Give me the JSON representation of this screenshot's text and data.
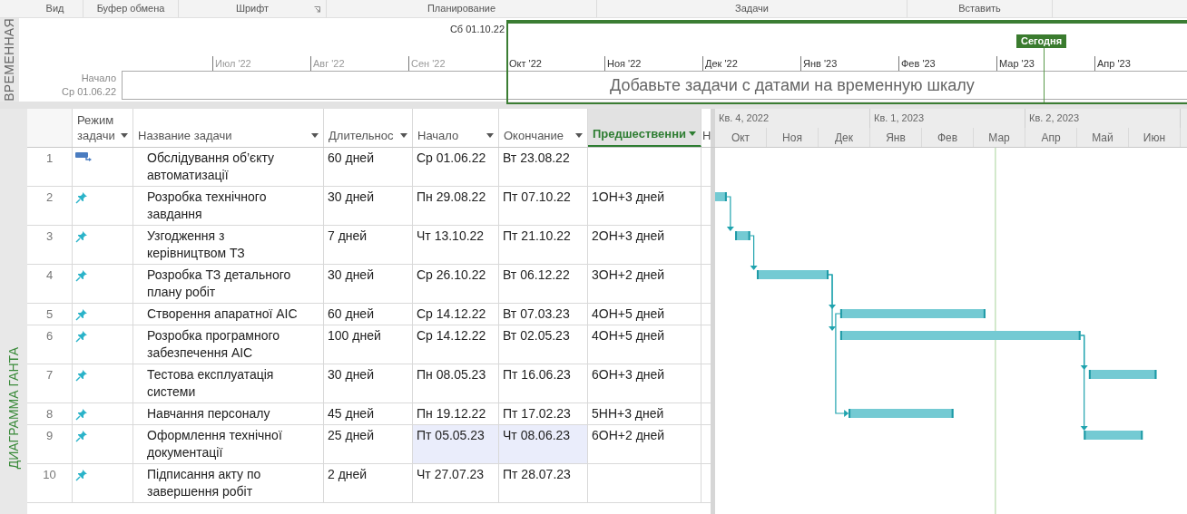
{
  "ribbon_groups": [
    {
      "label": "Вид",
      "launcher": false
    },
    {
      "label": "Буфер обмена",
      "launcher": false
    },
    {
      "label": "Шрифт",
      "launcher": true
    },
    {
      "label": "Планирование",
      "launcher": false
    },
    {
      "label": "Задачи",
      "launcher": false
    },
    {
      "label": "Вставить",
      "launcher": false
    }
  ],
  "timeline": {
    "side_label": "ВРЕМЕННАЯ",
    "window_date": "Сб 01.10.22",
    "start_label": "Начало",
    "start_date": "Ср 01.06.22",
    "today_badge": "Сегодня",
    "placeholder": "Добавьте задачи с датами на временную шкалу",
    "ticks": [
      {
        "label": "Июл '22",
        "in_range": false
      },
      {
        "label": "Авг '22",
        "in_range": false
      },
      {
        "label": "Сен '22",
        "in_range": false
      },
      {
        "label": "Окт '22",
        "in_range": true
      },
      {
        "label": "Ноя '22",
        "in_range": true
      },
      {
        "label": "Дек '22",
        "in_range": true
      },
      {
        "label": "Янв '23",
        "in_range": true
      },
      {
        "label": "Фев '23",
        "in_range": true
      },
      {
        "label": "Мар '23",
        "in_range": true
      },
      {
        "label": "Апр '23",
        "in_range": true
      }
    ]
  },
  "view_label": "ДИАГРАММА ГАНТА",
  "table": {
    "columns": [
      {
        "label": "Режим задачи",
        "selected": false
      },
      {
        "label": "Название задачи",
        "selected": false
      },
      {
        "label": "Длительнос",
        "selected": false
      },
      {
        "label": "Начало",
        "selected": false
      },
      {
        "label": "Окончание",
        "selected": false
      },
      {
        "label": "Предшественни",
        "selected": true
      }
    ],
    "column_8": "Н",
    "rows": [
      {
        "id": "1",
        "kind": "auto",
        "name": "Обслідування об’єкту автоматизації",
        "duration": "60 дней",
        "start": "Ср 01.06.22",
        "finish": "Вт 23.08.22",
        "dates_highlighted": false
      },
      {
        "id": "2",
        "kind": "manual",
        "name": "Розробка технічного завдання",
        "duration": "30 дней",
        "start": "Пн 29.08.22",
        "finish": "Пт 07.10.22",
        "predecessors": "1ОН+3 дней",
        "dates_highlighted": false
      },
      {
        "id": "3",
        "kind": "manual",
        "name": "Узгодження з керівництвом ТЗ",
        "duration": "7 дней",
        "start": "Чт 13.10.22",
        "finish": "Пт 21.10.22",
        "predecessors": "2ОН+3 дней",
        "link_from_start": false,
        "dates_highlighted": false
      },
      {
        "id": "4",
        "kind": "manual",
        "name": "Розробка ТЗ детального плану робіт",
        "duration": "30 дней",
        "start": "Ср 26.10.22",
        "finish": "Вт 06.12.22",
        "predecessors": "3ОН+2 дней",
        "link_from_start": false,
        "dates_highlighted": false
      },
      {
        "id": "5",
        "kind": "manual",
        "name": "Створення апаратної АІС",
        "duration": "60 дней",
        "start": "Ср 14.12.22",
        "finish": "Вт 07.03.23",
        "predecessors": "4ОН+5 дней",
        "link_from_start": false,
        "dates_highlighted": false
      },
      {
        "id": "6",
        "kind": "manual",
        "name": "Розробка програмного забезпечення АІС",
        "duration": "100 дней",
        "start": "Ср 14.12.22",
        "finish": "Вт 02.05.23",
        "predecessors": "4ОН+5 дней",
        "link_from_start": false,
        "dates_highlighted": false
      },
      {
        "id": "7",
        "kind": "manual",
        "name": "Тестова експлуатація системи",
        "duration": "30 дней",
        "start": "Пн 08.05.23",
        "finish": "Пт 16.06.23",
        "predecessors": "6ОН+3 дней",
        "link_from_start": false,
        "dates_highlighted": false
      },
      {
        "id": "8",
        "kind": "manual",
        "name": "Навчання персоналу",
        "duration": "45 дней",
        "start": "Пн 19.12.22",
        "finish": "Пт 17.02.23",
        "predecessors": "5НН+3 дней",
        "link_from_start": true,
        "dates_highlighted": false
      },
      {
        "id": "9",
        "kind": "manual",
        "name": "Оформлення технічної документації",
        "duration": "25 дней",
        "start": "Пт 05.05.23",
        "finish": "Чт 08.06.23",
        "predecessors": "6ОН+2 дней",
        "link_from_start": false,
        "dates_highlighted": true
      },
      {
        "id": "10",
        "kind": "manual",
        "name": "Підписання акту по завершення робіт",
        "duration": "2 дней",
        "start": "Чт 27.07.23",
        "finish": "Пт 28.07.23",
        "dates_highlighted": false
      }
    ]
  },
  "gantt": {
    "quarters": [
      "Кв. 4, 2022",
      "Кв. 1, 2023",
      "Кв. 2, 2023"
    ],
    "months": [
      "Окт",
      "Ноя",
      "Дек",
      "Янв",
      "Фев",
      "Мар",
      "Апр",
      "Май",
      "Июн"
    ]
  }
}
